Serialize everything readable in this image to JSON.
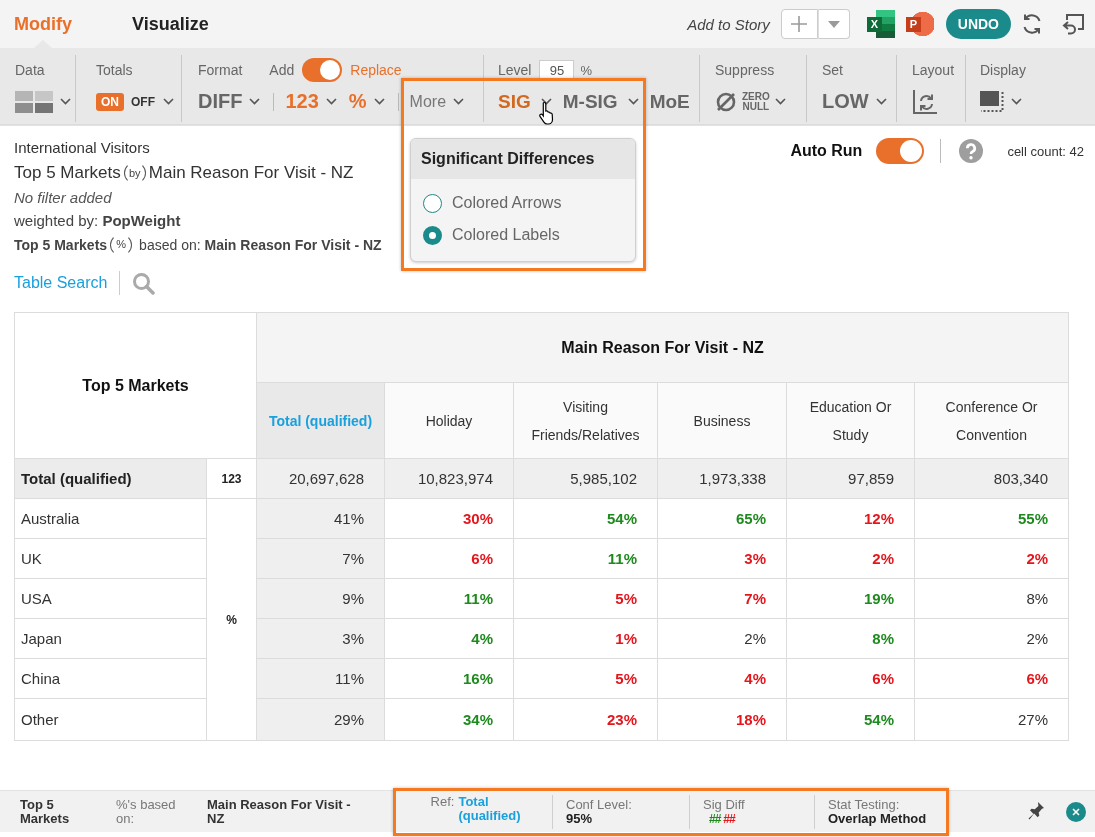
{
  "top_bar": {
    "tabs": [
      {
        "label": "Modify",
        "selected": true
      },
      {
        "label": "Visualize",
        "selected": false
      }
    ],
    "story_label": "Add to Story",
    "exports": [
      {
        "kind": "spreadsheet",
        "letter": "X"
      },
      {
        "kind": "slides",
        "letter": "P"
      }
    ],
    "undo": "UNDO"
  },
  "toolbar": {
    "data": {
      "label": "Data"
    },
    "totals": {
      "label": "Totals",
      "options": [
        {
          "label": "ON",
          "selected": true
        },
        {
          "label": "OFF",
          "selected": false
        }
      ]
    },
    "format": {
      "label": "Format",
      "mode": {
        "off_label": "Add",
        "on_label": "Replace",
        "on": true
      },
      "groups": [
        {
          "buttons": [
            {
              "label": "DIFF",
              "kind": "strong",
              "active": false,
              "menu": true
            }
          ]
        },
        {
          "buttons": [
            {
              "label": "123",
              "kind": "strong",
              "active": true,
              "menu": true
            },
            {
              "label": "%",
              "kind": "strong",
              "active": true,
              "menu": true
            }
          ]
        },
        {
          "buttons": [
            {
              "label": "More",
              "kind": "plain",
              "active": false,
              "menu": true
            }
          ]
        }
      ]
    },
    "level": {
      "label": "Level",
      "value": "95",
      "unit": "%",
      "buttons": [
        {
          "label": "SIG",
          "active": true,
          "menu": true
        },
        {
          "label": "M-SIG",
          "active": false,
          "menu": true
        },
        {
          "label": "MoE",
          "active": false,
          "menu": false
        }
      ]
    },
    "suppress": {
      "label": "Suppress",
      "option": "ZERO NULL"
    },
    "set": {
      "label": "Set",
      "value": "LOW"
    },
    "layout": {
      "label": "Layout"
    },
    "display": {
      "label": "Display"
    }
  },
  "sig_menu": {
    "title": "Significant Differences",
    "options": [
      {
        "label": "Colored Arrows",
        "selected": false
      },
      {
        "label": "Colored Labels",
        "selected": true
      }
    ]
  },
  "report": {
    "dataset": "International Visitors",
    "title": {
      "rows": "Top 5 Markets",
      "joiner": "by",
      "columns": "Main Reason For Visit - NZ"
    },
    "filter": "No filter added",
    "weight": "weighted by: **PopWeight**",
    "base": {
      "rows": "Top 5 Markets",
      "joiner": "%",
      "text": "based on: **Main Reason For Visit - NZ**"
    },
    "search": "Table Search"
  },
  "run_bar": {
    "auto_run": {
      "label": "Auto Run",
      "on": true
    },
    "cell_count": "cell count: 42"
  },
  "table": {
    "corner": "Top 5 Markets",
    "column_group": "Main Reason For Visit - NZ",
    "columns": [
      {
        "label": "Total (qualified)",
        "kind": "reference"
      },
      {
        "label": "Holiday",
        "kind": "category"
      },
      {
        "label": "Visiting Friends/Relatives",
        "kind": "category"
      },
      {
        "label": "Business",
        "kind": "category"
      },
      {
        "label": "Education Or Study",
        "kind": "category"
      },
      {
        "label": "Conference Or Convention",
        "kind": "category"
      }
    ],
    "total_row": {
      "label": "Total (qualified)",
      "statistic": "123",
      "values": [
        "20,697,628",
        "10,823,974",
        "5,985,102",
        "1,973,338",
        "97,859",
        "803,340"
      ]
    },
    "statistic": "%",
    "rows": [
      {
        "label": "Australia",
        "cells": [
          {
            "value": "41%",
            "kind": "same"
          },
          {
            "value": "30%",
            "kind": "lower"
          },
          {
            "value": "54%",
            "kind": "higher"
          },
          {
            "value": "65%",
            "kind": "higher"
          },
          {
            "value": "12%",
            "kind": "lower"
          },
          {
            "value": "55%",
            "kind": "higher"
          }
        ]
      },
      {
        "label": "UK",
        "cells": [
          {
            "value": "7%",
            "kind": "same"
          },
          {
            "value": "6%",
            "kind": "lower"
          },
          {
            "value": "11%",
            "kind": "higher"
          },
          {
            "value": "3%",
            "kind": "lower"
          },
          {
            "value": "2%",
            "kind": "lower"
          },
          {
            "value": "2%",
            "kind": "lower"
          }
        ]
      },
      {
        "label": "USA",
        "cells": [
          {
            "value": "9%",
            "kind": "same"
          },
          {
            "value": "11%",
            "kind": "higher"
          },
          {
            "value": "5%",
            "kind": "lower"
          },
          {
            "value": "7%",
            "kind": "lower"
          },
          {
            "value": "19%",
            "kind": "higher"
          },
          {
            "value": "8%",
            "kind": "same"
          }
        ]
      },
      {
        "label": "Japan",
        "cells": [
          {
            "value": "3%",
            "kind": "same"
          },
          {
            "value": "4%",
            "kind": "higher"
          },
          {
            "value": "1%",
            "kind": "lower"
          },
          {
            "value": "2%",
            "kind": "same"
          },
          {
            "value": "8%",
            "kind": "higher"
          },
          {
            "value": "2%",
            "kind": "same"
          }
        ]
      },
      {
        "label": "China",
        "cells": [
          {
            "value": "11%",
            "kind": "same"
          },
          {
            "value": "16%",
            "kind": "higher"
          },
          {
            "value": "5%",
            "kind": "lower"
          },
          {
            "value": "4%",
            "kind": "lower"
          },
          {
            "value": "6%",
            "kind": "lower"
          },
          {
            "value": "6%",
            "kind": "lower"
          }
        ]
      },
      {
        "label": "Other",
        "cells": [
          {
            "value": "29%",
            "kind": "same"
          },
          {
            "value": "34%",
            "kind": "higher"
          },
          {
            "value": "23%",
            "kind": "lower"
          },
          {
            "value": "18%",
            "kind": "lower"
          },
          {
            "value": "54%",
            "kind": "higher"
          },
          {
            "value": "27%",
            "kind": "same"
          }
        ]
      }
    ]
  },
  "footer": {
    "rows": "Top 5 Markets",
    "base_label": "%'s based on:",
    "base_value": "Main Reason For Visit - NZ",
    "stats": [
      {
        "kind": "reference",
        "label": "Ref:",
        "value": "Total (qualified)"
      },
      {
        "kind": "value",
        "label": "Conf Level:",
        "value": "95%"
      },
      {
        "kind": "legend",
        "label": "Sig Diff",
        "marks": [
          {
            "text": "##",
            "kind": "higher"
          },
          {
            "text": "##",
            "kind": "lower"
          }
        ]
      },
      {
        "kind": "value",
        "label": "Stat Testing:",
        "value": "Overlap Method"
      }
    ]
  }
}
